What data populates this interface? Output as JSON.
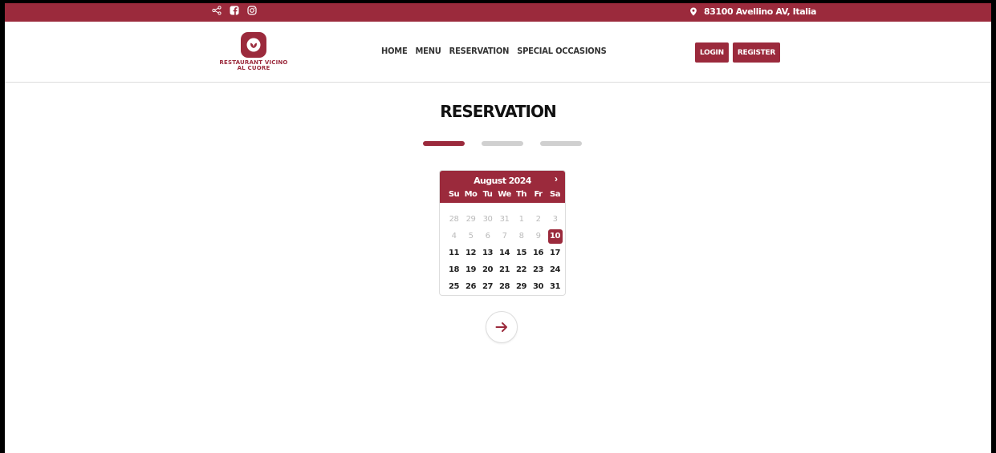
{
  "topbar": {
    "icons": [
      "share-icon",
      "facebook-icon",
      "instagram-icon"
    ],
    "location_icon": "map-pin-icon",
    "location": "83100 Avellino AV, Italia"
  },
  "header": {
    "logo_text": "RESTAURANT VICINO AL CUORE",
    "nav": [
      "HOME",
      "MENU",
      "RESERVATION",
      "SPECIAL OCCASIONS"
    ],
    "login_label": "LOGIN",
    "register_label": "REGISTER"
  },
  "main": {
    "title": "RESERVATION",
    "steps": {
      "total": 3,
      "active": 1
    },
    "calendar": {
      "month_label": "August 2024",
      "next_glyph": "›",
      "weekdays": [
        "Su",
        "Mo",
        "Tu",
        "We",
        "Th",
        "Fr",
        "Sa"
      ],
      "days": [
        [
          "28",
          "29",
          "30",
          "31",
          "1",
          "2",
          "3"
        ],
        [
          "4",
          "5",
          "6",
          "7",
          "8",
          "9",
          "10"
        ],
        [
          "11",
          "12",
          "13",
          "14",
          "15",
          "16",
          "17"
        ],
        [
          "18",
          "19",
          "20",
          "21",
          "22",
          "23",
          "24"
        ],
        [
          "25",
          "26",
          "27",
          "28",
          "29",
          "30",
          "31"
        ]
      ],
      "muted_count": 13,
      "selected": "10"
    },
    "next_button_icon": "arrow-right-icon"
  },
  "colors": {
    "brand": "#9b2a3c",
    "muted_bar": "#d0d0d0"
  }
}
